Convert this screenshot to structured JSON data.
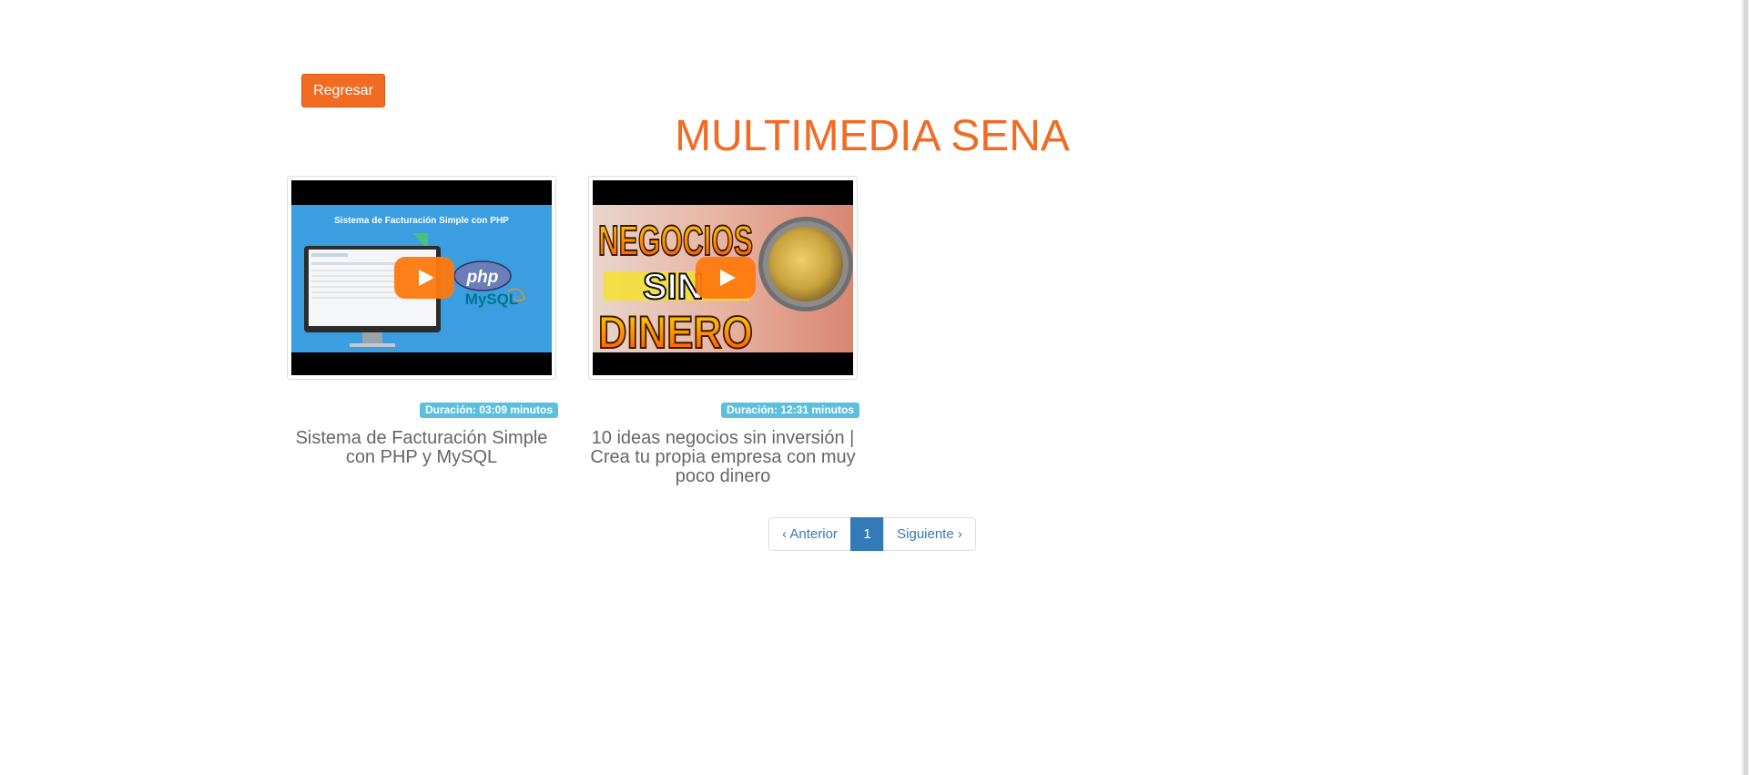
{
  "toolbar": {
    "back_label": "Regresar"
  },
  "header": {
    "title": "MULTIMEDIA SENA"
  },
  "videos": [
    {
      "title": "Sistema de Facturación Simple con PHP y MySQL",
      "duration": "Duración: 03:09 minutos",
      "thumbnail": {
        "heading": "Sistema de Facturación Simple con PHP",
        "logo_php": "php",
        "logo_mysql": "MySQL"
      }
    },
    {
      "title": "10 ideas negocios sin inversión | Crea tu propia empresa con muy poco dinero",
      "duration": "Duración: 12:31 minutos",
      "thumbnail": {
        "line1": "NEGOCIOS",
        "line2": "SIN",
        "line3": "DINERO"
      }
    }
  ],
  "pagination": {
    "prev": "‹ Anterior",
    "current": "1",
    "next": "Siguiente ›"
  },
  "colors": {
    "accent": "#f26b22",
    "badge": "#5bc0de",
    "link": "#337ab7"
  }
}
